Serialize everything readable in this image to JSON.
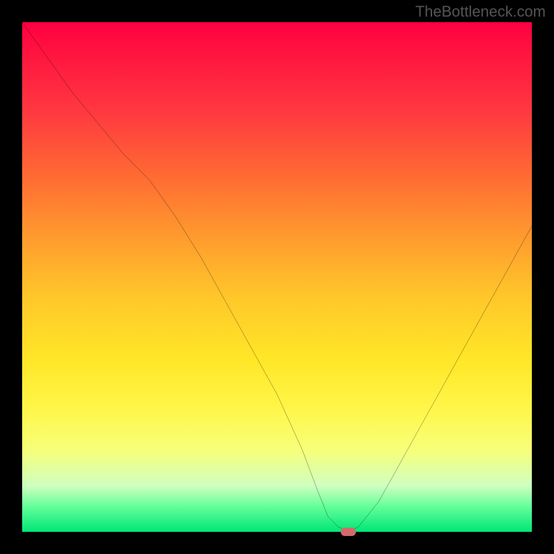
{
  "watermark": "TheBottleneck.com",
  "chart_data": {
    "type": "line",
    "title": "",
    "xlabel": "",
    "ylabel": "",
    "xlim": [
      0,
      100
    ],
    "ylim": [
      0,
      100
    ],
    "x": [
      0,
      5,
      10,
      15,
      20,
      25,
      30,
      35,
      40,
      45,
      50,
      55,
      58,
      60,
      62,
      64,
      66,
      70,
      75,
      80,
      85,
      90,
      95,
      100
    ],
    "values": [
      100,
      93,
      86,
      80,
      74,
      69,
      62,
      54,
      45,
      36,
      27,
      16,
      8,
      3,
      1,
      0,
      1,
      6,
      15,
      24,
      33,
      42,
      51,
      60
    ],
    "marker": {
      "x": 64,
      "y": 0
    },
    "gradient_stops": [
      {
        "pos": 0,
        "color": "#ff0040"
      },
      {
        "pos": 50,
        "color": "#ffc72a"
      },
      {
        "pos": 85,
        "color": "#f7ff7a"
      },
      {
        "pos": 100,
        "color": "#00e676"
      }
    ]
  }
}
